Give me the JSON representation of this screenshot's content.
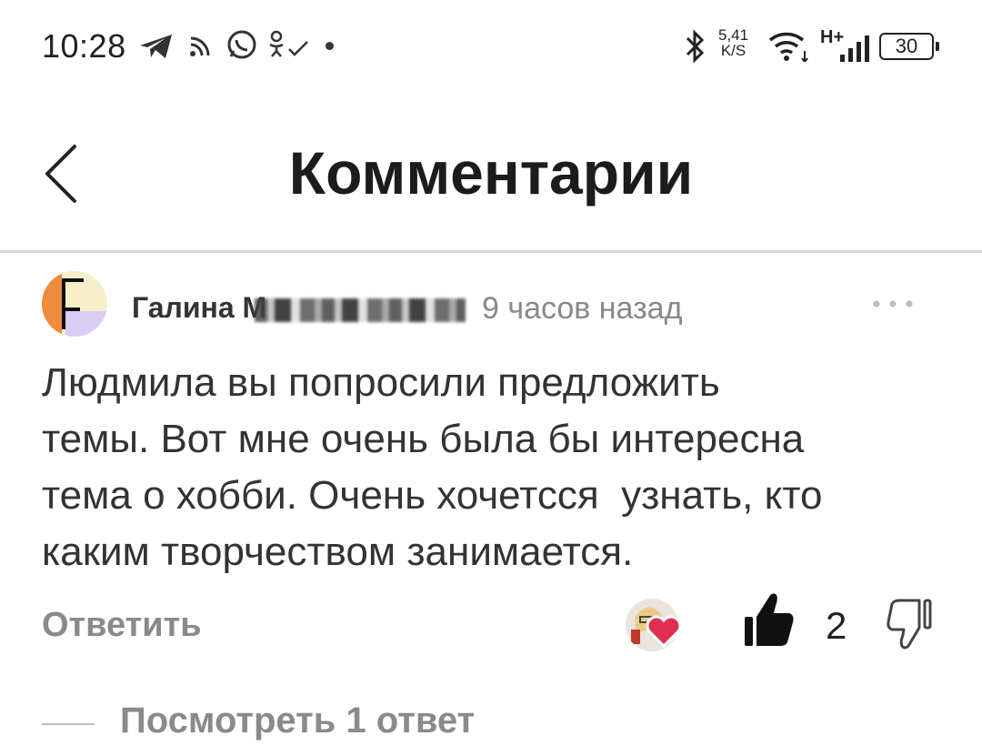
{
  "status_bar": {
    "time": "10:28",
    "net_speed_value": "5,41",
    "net_speed_unit": "K/S",
    "network_type": "H+",
    "battery": "30",
    "icons": [
      "telegram-icon",
      "rss-icon",
      "whatsapp-icon",
      "odnoklassniki-icon",
      "dot-icon",
      "bluetooth-icon",
      "wifi-icon",
      "signal-icon",
      "battery-icon"
    ]
  },
  "header": {
    "title": "Комментарии",
    "back_icon": "chevron-left-icon"
  },
  "comment": {
    "author": "Галина М",
    "time_ago": "9 часов назад",
    "text": "Людмила вы попросили предложить\nтемы. Вот мне очень была бы интересна\nтема о хобби. Очень хочетсся  узнать, кто\nкаким творчеством занимается.",
    "reply_label": "Ответить",
    "likes": "2",
    "more_icon": "more-horizontal-icon"
  },
  "replies": {
    "label": "Посмотреть 1 ответ"
  },
  "colors": {
    "avatar_orange": "#f08a3c",
    "avatar_cream": "#f7efc9",
    "avatar_lavender": "#d8cdf3",
    "heart": "#e0304f",
    "muted": "#8a8a8a"
  }
}
